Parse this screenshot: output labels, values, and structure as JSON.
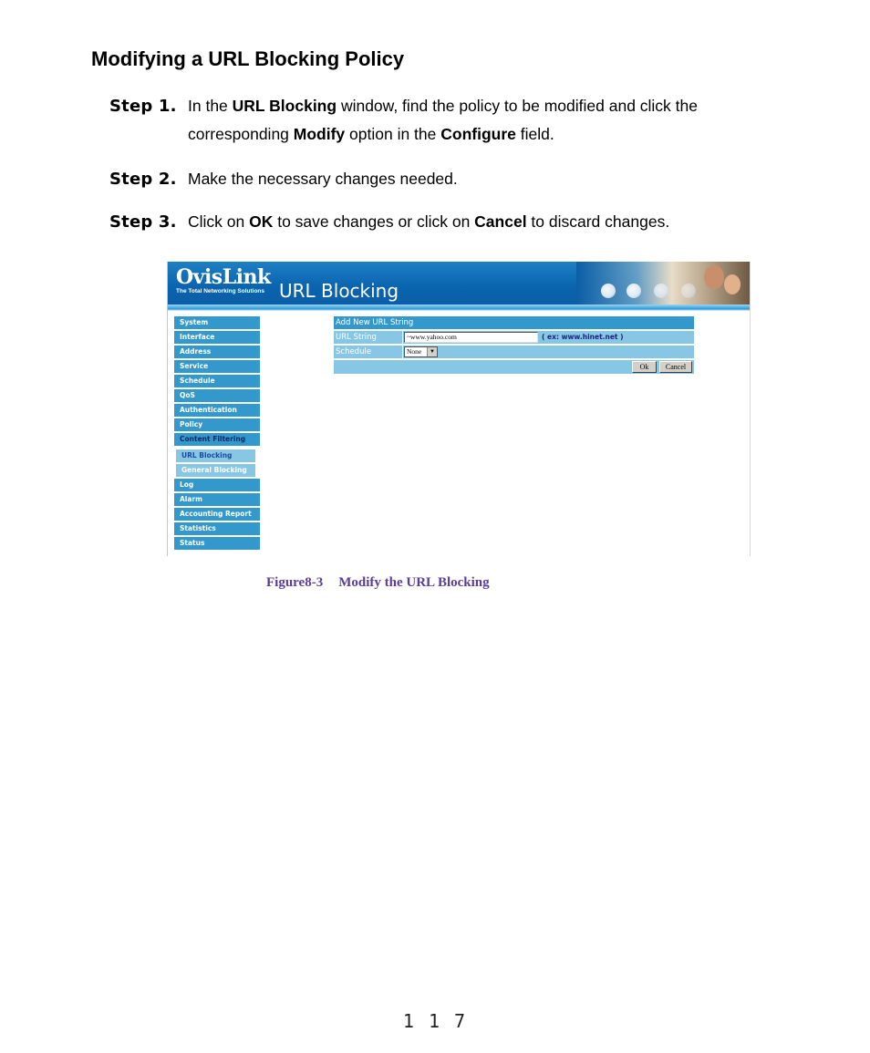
{
  "title": "Modifying a URL Blocking Policy",
  "steps": [
    {
      "label": "Step 1.",
      "parts": [
        "In the ",
        "URL Blocking",
        " window, find the policy to be modified and click the",
        "corresponding ",
        "Modify",
        " option in the ",
        "Configure",
        " field."
      ]
    },
    {
      "label": "Step 2.",
      "parts": [
        "Make the necessary changes needed."
      ]
    },
    {
      "label": "Step 3.",
      "parts": [
        "Click on ",
        "OK",
        " to save changes or click on ",
        "Cancel",
        " to discard changes."
      ]
    }
  ],
  "figure": {
    "logo_name": "OvisLink",
    "logo_tagline": "The Total Networking Solutions",
    "page_heading": "URL Blocking",
    "sidebar": {
      "items_top": [
        "System",
        "Interface",
        "Address",
        "Service",
        "Schedule",
        "QoS",
        "Authentication",
        "Policy",
        "Content Filtering"
      ],
      "sub_items": [
        "URL Blocking",
        "General Blocking"
      ],
      "items_bottom": [
        "Log",
        "Alarm",
        "Accounting Report",
        "Statistics",
        "Status"
      ]
    },
    "form": {
      "header": "Add New URL String",
      "url_label": "URL String",
      "url_value": "~www.yahoo.com",
      "url_hint": "( ex: www.hinet.net )",
      "schedule_label": "Schedule",
      "schedule_value": "None",
      "ok_label": "Ok",
      "cancel_label": "Cancel"
    },
    "colors": {
      "nav": "#3399cc",
      "subnav": "#87c6e5",
      "banner": "#0a64ae"
    }
  },
  "caption": {
    "number": "Figure8-3",
    "text": "Modify the URL Blocking"
  },
  "page_number": "117"
}
